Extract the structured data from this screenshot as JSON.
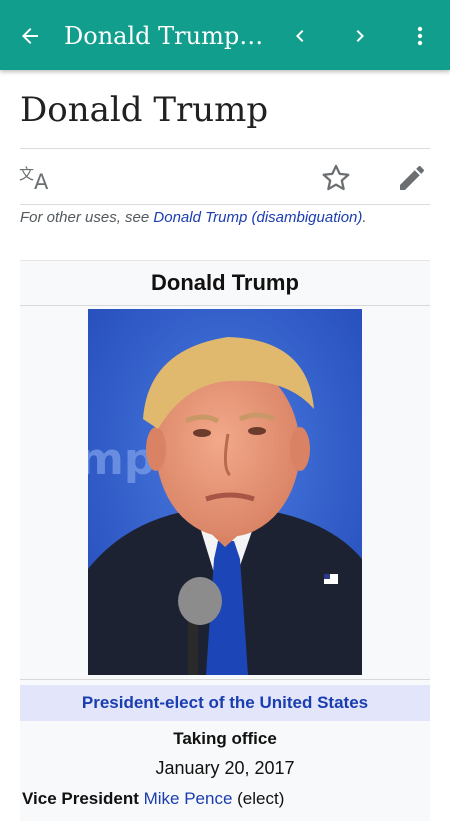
{
  "app_bar": {
    "title": "Donald Trump (disambiguation)",
    "background": "#129e8c",
    "icons": [
      "back-arrow-icon",
      "chevron-left-icon",
      "chevron-right-icon",
      "more-vert-icon"
    ]
  },
  "article": {
    "title": "Donald Trump",
    "actions": [
      "translate-icon",
      "star-icon",
      "pencil-icon"
    ],
    "hatnote_prefix": "For other uses, see ",
    "hatnote_link": "Donald Trump (disambiguation)",
    "hatnote_suffix": "."
  },
  "infobox": {
    "name": "Donald Trump",
    "role": "President-elect of the United States",
    "taking_office_label": "Taking office",
    "taking_office_date": "January 20, 2017",
    "vp_label": "Vice President",
    "vp_name": "Mike Pence",
    "vp_suffix": " (elect)",
    "role_bg": "#e3e6fb",
    "link_color": "#1a3db0"
  }
}
